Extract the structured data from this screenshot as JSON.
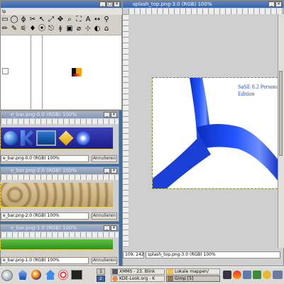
{
  "toolbox": {
    "menu_fragment": "lp",
    "tools_row1": [
      "▭",
      "◯",
      "ϕ",
      "✂",
      "↖",
      "⤢",
      "✥",
      "⌕",
      "⛶",
      "A",
      "↔",
      "⚲"
    ],
    "tools_row2": [
      "✏",
      "✎",
      "⚟",
      "♦",
      "⦿",
      "⎋",
      "ǂ",
      "▣",
      "⌀",
      "⊹",
      "◐",
      "⌂"
    ]
  },
  "image1": {
    "title": "e_bar.png-0.0 (RGB) 100%",
    "status": "e_bar.png-0.0 (RGB) 100%",
    "cancel": "Annulieren"
  },
  "image2": {
    "title": "e_bar.png-2.0 (RGB) 100%",
    "status": "e_bar.png-2.0 (RGB) 100%",
    "cancel": "Annulieren"
  },
  "image3": {
    "title": "e_bar.png-1.0 (RGB) 100%",
    "status": "e_bar.png-1.0 (RGB) 100%",
    "cancel": "Annulieren"
  },
  "main": {
    "title": "splash_top.png-3.0 (RGB) 100%",
    "canvas_text_line1": "SuSE 8.2 Personal",
    "canvas_text_line2": "Edition",
    "coords": "109, 242",
    "status": "splash_top.png-3.0 (RGB) 100%"
  },
  "taskbar": {
    "pager": [
      "1",
      "2"
    ],
    "tasks": [
      "XMMS - 23. Blink",
      "Lokale mappen/",
      "KDE-Look.org - K",
      "Gimp [5]"
    ],
    "active_task": "Gimp [5]"
  },
  "colors": {
    "accent": "#3a63a8",
    "desktop": "#3a6ea5",
    "window_bg": "#d4d0c8",
    "shape_blue": "#1a3fd6"
  }
}
